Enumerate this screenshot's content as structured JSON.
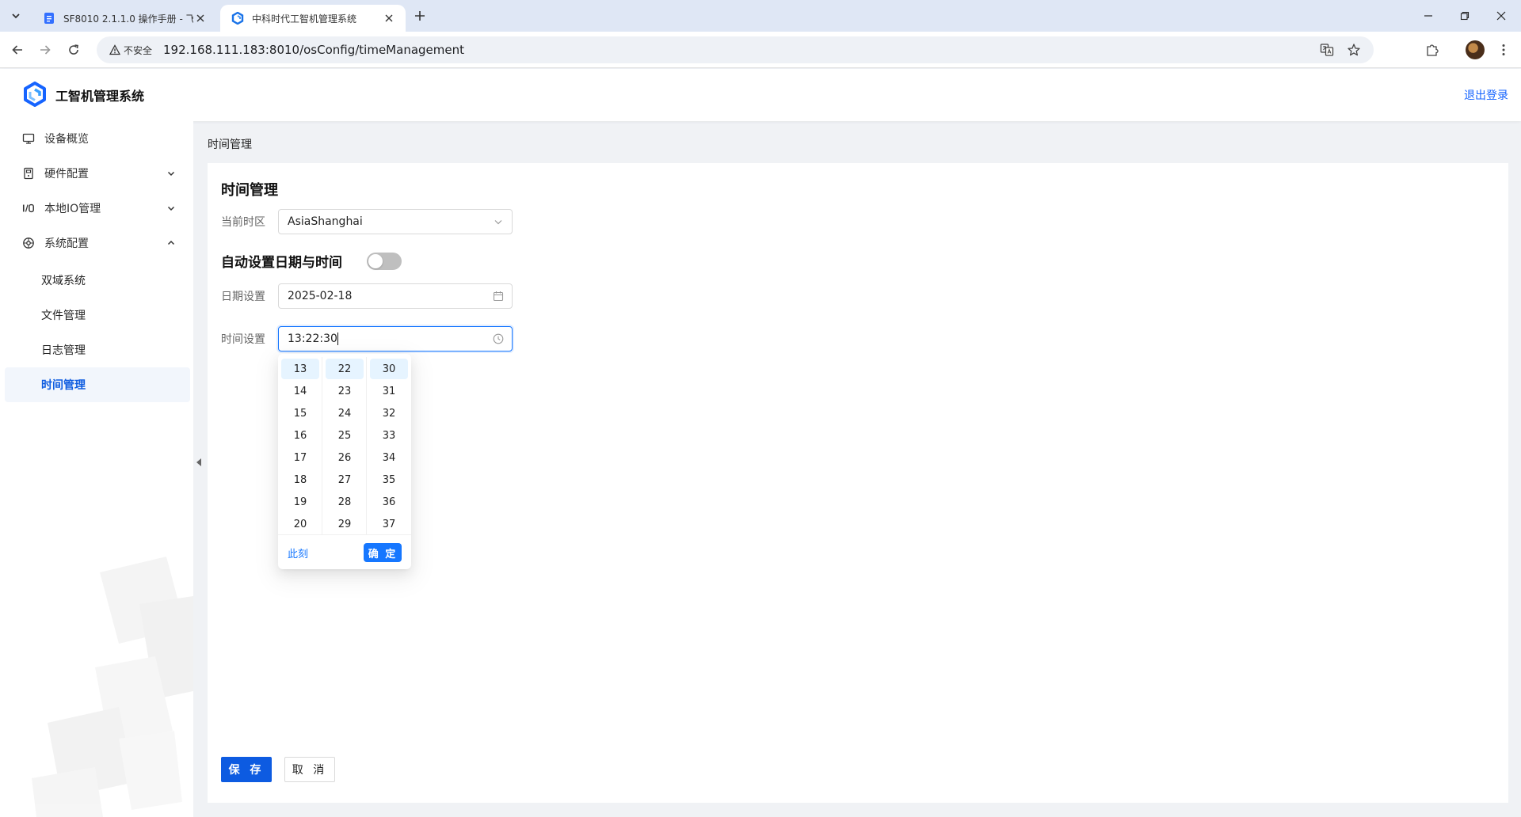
{
  "browser": {
    "tabs": [
      {
        "title": "SF8010 2.1.1.0 操作手册 - 飞书",
        "active": false
      },
      {
        "title": "中科时代工智机管理系统",
        "active": true
      }
    ],
    "security_label": "不安全",
    "url": "192.168.111.183:8010/osConfig/timeManagement"
  },
  "header": {
    "app_title": "工智机管理系统",
    "logout": "退出登录"
  },
  "sidebar": {
    "items": [
      {
        "label": "设备概览",
        "icon": "monitor-icon"
      },
      {
        "label": "硬件配置",
        "icon": "hardware-icon"
      },
      {
        "label": "本地IO管理",
        "icon": "io-icon"
      },
      {
        "label": "系统配置",
        "icon": "system-icon"
      }
    ],
    "subitems": [
      {
        "label": "双域系统"
      },
      {
        "label": "文件管理"
      },
      {
        "label": "日志管理"
      },
      {
        "label": "时间管理",
        "active": true
      }
    ]
  },
  "content": {
    "breadcrumb": "时间管理",
    "title": "时间管理",
    "timezone": {
      "label": "当前时区",
      "value": "AsiaShanghai"
    },
    "auto": {
      "label": "自动设置日期与时间",
      "enabled": false
    },
    "date": {
      "label": "日期设置",
      "value": "2025-02-18"
    },
    "time": {
      "label": "时间设置",
      "value": "13:22:30"
    },
    "picker": {
      "hours": [
        "13",
        "14",
        "15",
        "16",
        "17",
        "18",
        "19",
        "20"
      ],
      "minutes": [
        "22",
        "23",
        "24",
        "25",
        "26",
        "27",
        "28",
        "29"
      ],
      "seconds": [
        "30",
        "31",
        "32",
        "33",
        "34",
        "35",
        "36",
        "37"
      ],
      "now": "此刻",
      "ok": "确 定"
    },
    "save": "保 存",
    "cancel": "取 消"
  },
  "colors": {
    "primary": "#1677ff",
    "save_button": "#0d5be1",
    "active_menu_text": "#0e5ce0"
  }
}
